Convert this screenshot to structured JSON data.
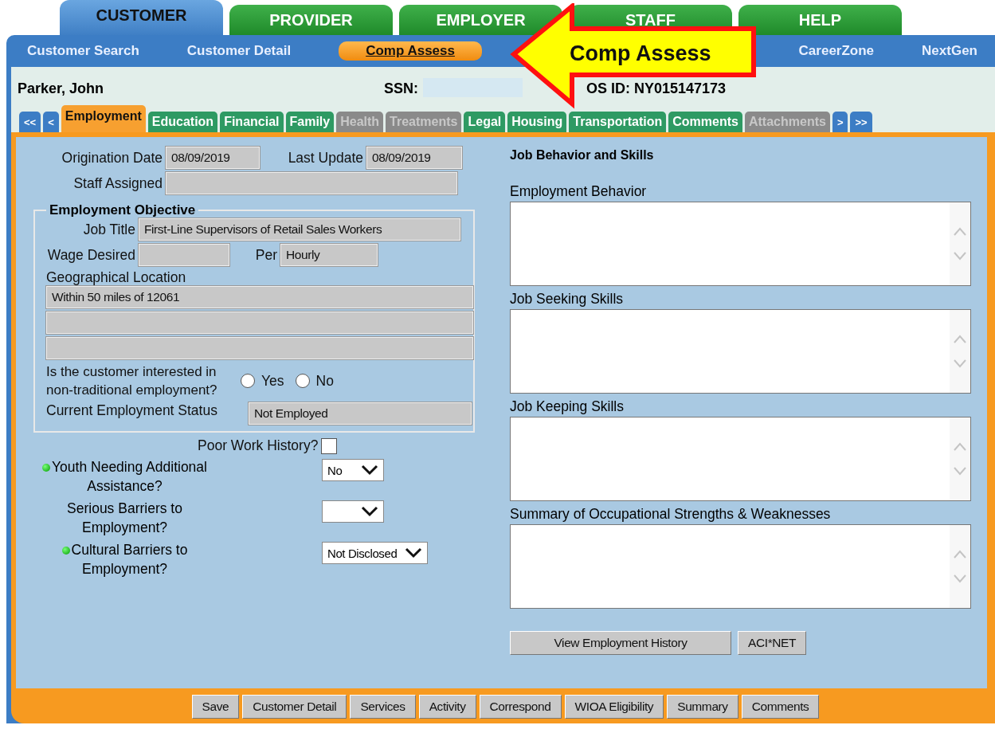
{
  "top_tabs": [
    {
      "label": "CUSTOMER",
      "selected": true
    },
    {
      "label": "PROVIDER",
      "selected": false
    },
    {
      "label": "EMPLOYER",
      "selected": false
    },
    {
      "label": "STAFF",
      "selected": false
    },
    {
      "label": "HELP",
      "selected": false
    }
  ],
  "nav_links": [
    {
      "label": "Customer Search",
      "selected": false
    },
    {
      "label": "Customer Detail",
      "selected": false
    },
    {
      "label": "Comp Assess",
      "selected": true
    },
    {
      "label": "CareerZone",
      "selected": false
    },
    {
      "label": "NextGen",
      "selected": false
    }
  ],
  "customer": {
    "name": "Parker, John",
    "ssn_label": "SSN:",
    "osos_id": "OS ID: NY015147173"
  },
  "sub_tabs": [
    {
      "label": "<<",
      "kind": "nav"
    },
    {
      "label": "<",
      "kind": "nav"
    },
    {
      "label": "Employment",
      "kind": "tab",
      "selected": true,
      "disabled": false
    },
    {
      "label": "Education",
      "kind": "tab",
      "selected": false,
      "disabled": false
    },
    {
      "label": "Financial",
      "kind": "tab",
      "selected": false,
      "disabled": false
    },
    {
      "label": "Family",
      "kind": "tab",
      "selected": false,
      "disabled": false
    },
    {
      "label": "Health",
      "kind": "tab",
      "selected": false,
      "disabled": true
    },
    {
      "label": "Treatments",
      "kind": "tab",
      "selected": false,
      "disabled": true
    },
    {
      "label": "Legal",
      "kind": "tab",
      "selected": false,
      "disabled": false
    },
    {
      "label": "Housing",
      "kind": "tab",
      "selected": false,
      "disabled": false
    },
    {
      "label": "Transportation",
      "kind": "tab",
      "selected": false,
      "disabled": false
    },
    {
      "label": "Comments",
      "kind": "tab",
      "selected": false,
      "disabled": false
    },
    {
      "label": "Attachments",
      "kind": "tab",
      "selected": false,
      "disabled": true
    },
    {
      "label": ">",
      "kind": "nav"
    },
    {
      "label": ">>",
      "kind": "nav"
    }
  ],
  "form": {
    "origination_date": {
      "label": "Origination Date",
      "value": "08/09/2019"
    },
    "last_update": {
      "label": "Last Update",
      "value": "08/09/2019"
    },
    "staff_assigned": {
      "label": "Staff Assigned"
    },
    "objective": {
      "title": "Employment Objective",
      "job_title": {
        "label": "Job Title",
        "value": "First-Line Supervisors of Retail Sales Workers"
      },
      "wage_desired": {
        "label": "Wage Desired"
      },
      "per": {
        "label": "Per",
        "value": "Hourly"
      },
      "location_label": "Geographical Location",
      "locations": [
        {
          "kind": "field",
          "value": "Within 50 miles of 12061"
        },
        {
          "kind": "field"
        },
        {
          "kind": "field"
        }
      ],
      "non_traditional": {
        "question": "Is the customer interested in non-traditional employment?",
        "options": [
          {
            "label": "Yes",
            "selected": false
          },
          {
            "label": "No",
            "selected": false
          }
        ]
      },
      "status": {
        "label": "Current Employment Status",
        "value": "Not Employed"
      }
    },
    "poor_work_history": {
      "label": "Poor Work History?",
      "checked": false
    },
    "selects": [
      {
        "label": "Youth Needing Additional Assistance?",
        "required": true,
        "value": "No"
      },
      {
        "label": "Serious Barriers to Employment?",
        "required": false
      },
      {
        "label": "Cultural Barriers to Employment?",
        "required": true,
        "value": "Not Disclosed"
      }
    ]
  },
  "skills": {
    "title": "Job Behavior and Skills",
    "areas": [
      "Employment Behavior",
      "Job Seeking Skills",
      "Job Keeping Skills",
      "Summary of Occupational Strengths & Weaknesses"
    ],
    "buttons": [
      "View Employment History",
      "ACI*NET"
    ]
  },
  "bottom_buttons": [
    "Save",
    "Customer Detail",
    "Services",
    "Activity",
    "Correspond",
    "WIOA Eligibility",
    "Summary",
    "Comments"
  ],
  "callout": {
    "text": "Comp Assess"
  }
}
